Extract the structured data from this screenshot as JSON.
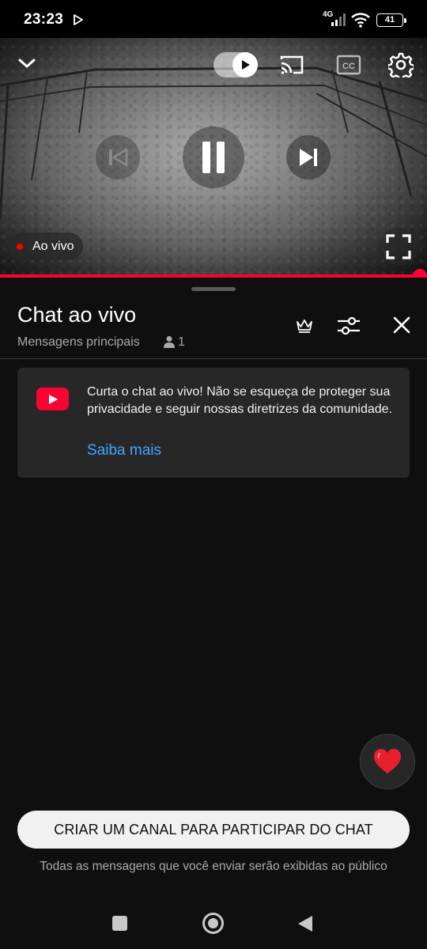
{
  "status_bar": {
    "time": "23:23",
    "network": "4G",
    "battery": "41"
  },
  "player": {
    "live_label": "Ao vivo",
    "progress_fraction": 1.0,
    "icons": [
      "chevron-down-icon",
      "autoplay-toggle",
      "cast-icon",
      "closed-captions-icon",
      "gear-icon",
      "previous-icon",
      "pause-icon",
      "next-icon",
      "fullscreen-icon"
    ]
  },
  "chat": {
    "title": "Chat ao vivo",
    "mode": "Mensagens principais",
    "viewer_count": "1",
    "welcome_message": "Curta o chat ao vivo! Não se esqueça de proteger sua privacidade e seguir nossas diretrizes da comunidade.",
    "learn_more": "Saiba mais",
    "create_channel_button": "CRIAR UM CANAL PARA PARTICIPAR DO CHAT",
    "public_notice": "Todas as mensagens que você enviar serão exibidas ao público"
  },
  "colors": {
    "accent_red": "#ff0033",
    "link_blue": "#3ea6ff",
    "background": "#0f0f0f",
    "card": "#272727"
  }
}
